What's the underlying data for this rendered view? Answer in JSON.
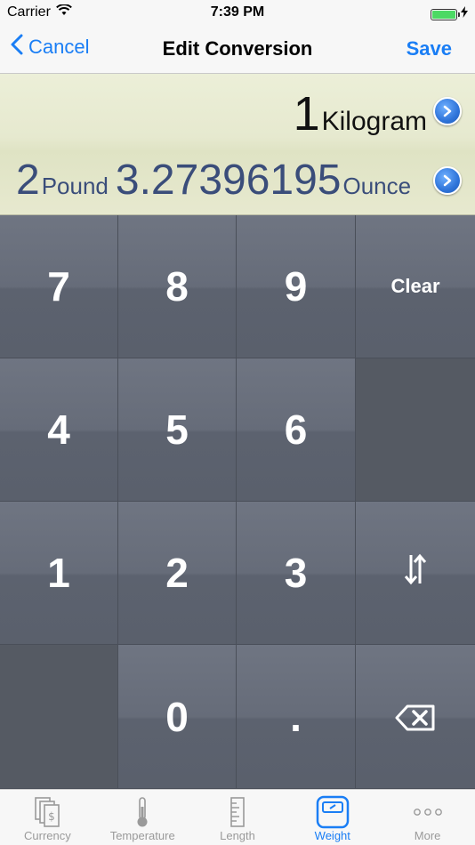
{
  "status_bar": {
    "carrier": "Carrier",
    "time": "7:39 PM",
    "battery_level": 1.0
  },
  "nav": {
    "back_label": "Cancel",
    "title": "Edit Conversion",
    "save_label": "Save"
  },
  "display": {
    "input_value": "1",
    "input_unit": "Kilogram",
    "output_value1": "2",
    "output_unit1": "Pound",
    "output_value2": "3.27396195",
    "output_unit2": "Ounce"
  },
  "keypad": {
    "keys": [
      "7",
      "8",
      "9",
      "Clear",
      "4",
      "5",
      "6",
      "",
      "1",
      "2",
      "3",
      "swap",
      "",
      "0",
      ".",
      "backspace"
    ]
  },
  "tabs": [
    {
      "label": "Currency",
      "icon": "currency-icon",
      "active": false
    },
    {
      "label": "Temperature",
      "icon": "thermometer-icon",
      "active": false
    },
    {
      "label": "Length",
      "icon": "ruler-icon",
      "active": false
    },
    {
      "label": "Weight",
      "icon": "scale-icon",
      "active": true
    },
    {
      "label": "More",
      "icon": "more-icon",
      "active": false
    }
  ],
  "colors": {
    "accent": "#1a7ef5",
    "display_text": "#3a4d7a",
    "key_bg": "#666c79"
  }
}
